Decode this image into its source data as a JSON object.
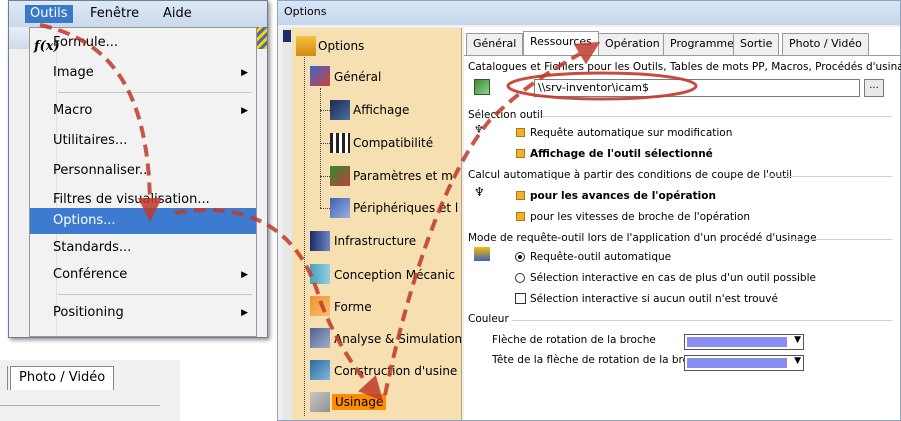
{
  "menu_window": {
    "menubar": [
      "Outils",
      "Fenêtre",
      "Aide"
    ],
    "items": [
      {
        "label": "Formule...",
        "icon": "fx-icon",
        "submenu": false
      },
      {
        "label": "Image",
        "submenu": true
      },
      {
        "label": "Macro",
        "submenu": true
      },
      {
        "label": "Utilitaires...",
        "submenu": false
      },
      {
        "label": "Personnaliser...",
        "submenu": false
      },
      {
        "label": "Filtres de visualisation...",
        "submenu": false
      },
      {
        "label": "Options...",
        "submenu": false,
        "selected": true
      },
      {
        "label": "Standards...",
        "submenu": false
      },
      {
        "label": "Conférence",
        "submenu": true
      },
      {
        "label": "Positioning",
        "submenu": true
      }
    ],
    "fx_glyph": "f(x)",
    "arrow_glyph": "▶"
  },
  "tab_fragment": {
    "label": "Photo / Vidéo"
  },
  "options_window": {
    "title": "Options",
    "tree": {
      "root": "Options",
      "items": [
        {
          "label": "Général",
          "icon": "general-icon"
        },
        {
          "label": "Affichage",
          "icon": "display-icon"
        },
        {
          "label": "Compatibilité",
          "icon": "compatibility-icon"
        },
        {
          "label": "Paramètres et m",
          "icon": "parameters-icon"
        },
        {
          "label": "Périphériques et l",
          "icon": "peripherals-icon"
        },
        {
          "label": "Infrastructure",
          "icon": "infrastructure-icon"
        },
        {
          "label": "Conception Mécanic",
          "icon": "mechanical-design-icon"
        },
        {
          "label": "Forme",
          "icon": "shape-icon"
        },
        {
          "label": "Analyse & Simulation",
          "icon": "analysis-icon"
        },
        {
          "label": "Construction d'usine",
          "icon": "plant-icon"
        },
        {
          "label": "Usinage",
          "icon": "machining-icon",
          "selected": true
        }
      ]
    },
    "tabs": [
      "Général",
      "Ressources",
      "Opération",
      "Programme",
      "Sortie",
      "Photo / Vidéo"
    ],
    "active_tab": "Ressources",
    "catalogues_label": "Catalogues et Fichiers pour les Outils, Tables de mots PP, Macros, Procédés d'usinages",
    "path_value": "\\\\srv-inventor\\icam$",
    "browse_label": "...",
    "tool_selection": {
      "heading": "Sélection outil",
      "options": [
        "Requête automatique sur modification",
        "Affichage de l'outil sélectionné"
      ]
    },
    "auto_calc": {
      "heading": "Calcul automatique à partir des conditions de coupe de l'outil",
      "options": [
        "pour les avances de l'opération",
        "pour les vitesses de broche de l'opération"
      ]
    },
    "query_mode": {
      "heading": "Mode de requête-outil lors de l'application d'un procédé d'usinage",
      "options": [
        "Requête-outil automatique",
        "Sélection interactive en cas de plus d'un outil possible",
        "Sélection interactive si aucun outil n'est trouvé"
      ]
    },
    "color": {
      "heading": "Couleur",
      "rows": [
        {
          "label": "Flèche de rotation de la broche",
          "swatch": "#8a8ef0"
        },
        {
          "label": "Tête de la flèche de rotation de la broche",
          "swatch": "#8a8ef0"
        }
      ]
    }
  },
  "colors": {
    "arrow": "#c0392b",
    "highlight_circle": "#c0392b",
    "selection": "#3d7bd0",
    "tree_bg": "#f6dfb0"
  }
}
